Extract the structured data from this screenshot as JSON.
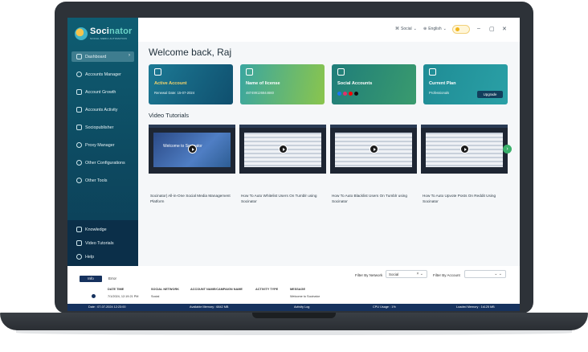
{
  "app": {
    "name_prefix": "Soci",
    "name_suffix": "nator",
    "tagline": "SOCIAL MEDIA AUTOMATION"
  },
  "sidebar": {
    "items": [
      {
        "label": "Dashboard",
        "icon": "dashboard-icon",
        "active": true
      },
      {
        "label": "Accounts Manager",
        "icon": "accounts-icon"
      },
      {
        "label": "Account Growth",
        "icon": "growth-icon"
      },
      {
        "label": "Accounts Activity",
        "icon": "activity-icon"
      },
      {
        "label": "Sociopublisher",
        "icon": "publisher-icon"
      },
      {
        "label": "Proxy Manager",
        "icon": "proxy-icon"
      },
      {
        "label": "Other Configurations",
        "icon": "config-icon"
      },
      {
        "label": "Other Tools",
        "icon": "tools-icon"
      }
    ],
    "bottom_items": [
      {
        "label": "Knowledge",
        "icon": "knowledge-icon"
      },
      {
        "label": "Video Tutorials",
        "icon": "video-icon"
      },
      {
        "label": "Help",
        "icon": "help-icon"
      }
    ]
  },
  "header": {
    "network": "Social",
    "language": "English"
  },
  "main": {
    "welcome": "Welcome back, Raj",
    "cards": [
      {
        "title": "Active Account",
        "sub": "Renewal Date: 15-07-2024",
        "icon": "account-icon"
      },
      {
        "title": "Name of license",
        "sub": "487499126844660",
        "icon": "license-icon"
      },
      {
        "title": "Social Accounts",
        "sub": "",
        "icon": "megaphone-icon"
      },
      {
        "title": "Current Plan",
        "sub": "Professionals",
        "icon": "plan-icon",
        "button": "Upgrade"
      }
    ],
    "video_tutorials_title": "Video Tutorials",
    "videos": [
      {
        "caption": "Socinator| All-in-One Social Media Management Platform",
        "overlay": "Welcome to Socinator"
      },
      {
        "caption": "How To Auto Whitelist Users On Tumblr using Socinator"
      },
      {
        "caption": "How To Auto Blacklist Users On Tumblr using Socinator"
      },
      {
        "caption": "How To Auto Upvote Posts On Reddit Using Socinator"
      }
    ]
  },
  "logs": {
    "tabs": [
      "Info",
      "Error"
    ],
    "filter_network_label": "Filter By Network",
    "filter_network_value": "Social",
    "filter_account_label": "Filter By Account",
    "columns": [
      "DATE TIME",
      "SOCIAL NETWORK",
      "ACCOUNT NAME/CAMPAIGN NAME",
      "ACTIVITY TYPE",
      "MESSAGE"
    ],
    "rows": [
      {
        "datetime": "7/1/2024, 12:19:21 PM",
        "network": "Social",
        "account": "",
        "activity": "",
        "message": "Welcome to Socinator"
      }
    ]
  },
  "status": {
    "date": "Date : 07-07-2024 12:23:00",
    "available_memory": "Available Memory : 6842 MB",
    "activity_log": "Activity Log",
    "cpu": "CPU Usage : 1%",
    "loaded_memory": "Loaded Memory : 1k125 MB"
  }
}
